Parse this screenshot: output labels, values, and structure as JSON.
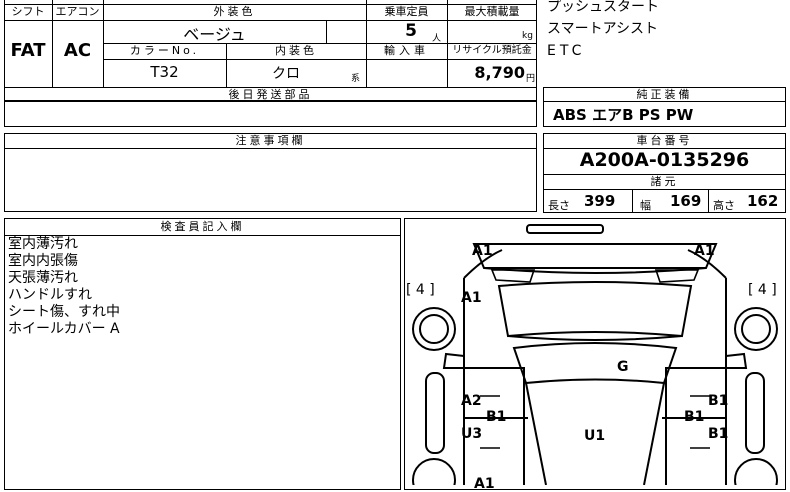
{
  "header": {
    "shift_label": "シフト",
    "aircon_label": "エアコン",
    "ext_color_label": "外装色",
    "capacity_label": "乗車定員",
    "load_label": "最大積載量",
    "color_no_label": "カラーNo.",
    "int_color_label": "内装色",
    "import_label": "輸入車",
    "recycle_label": "リサイクル預託金"
  },
  "values": {
    "shift": "FAT",
    "aircon": "AC",
    "ext_color": "ベージュ",
    "capacity": "5",
    "capacity_unit": "人",
    "load_unit": "kg",
    "color_no": "T32",
    "int_color": "クロ",
    "int_suffix": "系",
    "recycle": "8,790",
    "recycle_unit": "円"
  },
  "options_list": [
    "プッシュスタート",
    "スマートアシスト",
    "ETC"
  ],
  "later_parts": {
    "label": "後日発送部品"
  },
  "factory_equipment": {
    "label": "純正装備",
    "value": "ABS エアB PS PW"
  },
  "notes": {
    "label": "注意事項欄"
  },
  "chassis": {
    "label": "車台番号",
    "value": "A200A-0135296"
  },
  "specs": {
    "label": "諸元",
    "length_label": "長さ",
    "length": "399",
    "width_label": "幅",
    "width": "169",
    "height_label": "高さ",
    "height": "162"
  },
  "inspector": {
    "label": "検査員記入欄",
    "lines": [
      "室内薄汚れ",
      "室内内張傷",
      "天張薄汚れ",
      "ハンドルすれ",
      "シート傷、すれ中",
      "ホイールカバー A"
    ]
  },
  "diagram": {
    "tire_left": "[ 4 ]",
    "tire_right": "[ 4 ]",
    "marks": {
      "front_left": "A1",
      "front_right": "A1",
      "fender_left": "A1",
      "hood": "G",
      "door_left_front": "A2",
      "door_left_b": "B1",
      "door_right_b": "B1",
      "door_right_front": "B1",
      "door_left_rear": "U3",
      "roof": "U1",
      "door_right_rear": "B1",
      "rear_left": "A1"
    }
  }
}
